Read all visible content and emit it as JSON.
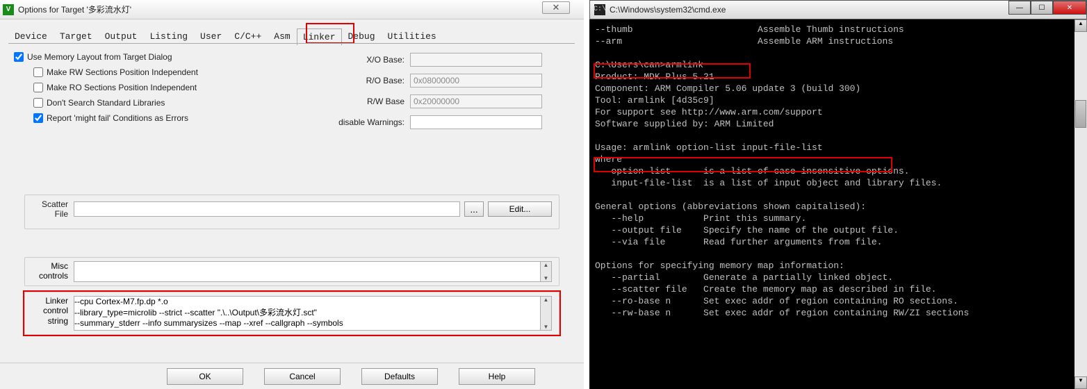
{
  "options": {
    "title": "Options for Target '多彩流水灯'",
    "close_label": "✕",
    "tabs": [
      "Device",
      "Target",
      "Output",
      "Listing",
      "User",
      "C/C++",
      "Asm",
      "Linker",
      "Debug",
      "Utilities"
    ],
    "active_tab_index": 7,
    "checks": {
      "use_memory_layout": {
        "label": "Use Memory Layout from Target Dialog",
        "checked": true
      },
      "make_rw": {
        "label": "Make RW Sections Position Independent",
        "checked": false
      },
      "make_ro": {
        "label": "Make RO Sections Position Independent",
        "checked": false
      },
      "dont_search": {
        "label": "Don't Search Standard Libraries",
        "checked": false
      },
      "report_might_fail": {
        "label": "Report 'might fail' Conditions as Errors",
        "checked": true
      }
    },
    "fields": {
      "xo_base": {
        "label": "X/O Base:",
        "value": ""
      },
      "ro_base": {
        "label": "R/O Base:",
        "value": "0x08000000"
      },
      "rw_base": {
        "label": "R/W Base",
        "value": "0x20000000"
      },
      "disable_warnings": {
        "label": "disable Warnings:",
        "value": ""
      }
    },
    "scatter": {
      "label": "Scatter\nFile",
      "value": "",
      "browse": "...",
      "edit": "Edit..."
    },
    "misc": {
      "label": "Misc\ncontrols",
      "value": ""
    },
    "linker_ctrl": {
      "label": "Linker\ncontrol\nstring",
      "value": "--cpu Cortex-M7.fp.dp *.o\n--library_type=microlib --strict --scatter \".\\..\\Output\\多彩流水灯.sct\"\n--summary_stderr --info summarysizes --map --xref --callgraph --symbols"
    },
    "buttons": {
      "ok": "OK",
      "cancel": "Cancel",
      "defaults": "Defaults",
      "help": "Help"
    }
  },
  "cmd": {
    "title": "C:\\Windows\\system32\\cmd.exe",
    "lines": [
      "--thumb                       Assemble Thumb instructions",
      "--arm                         Assemble ARM instructions",
      "",
      "C:\\Users\\can>armlink",
      "Product: MDK Plus 5.21",
      "Component: ARM Compiler 5.06 update 3 (build 300)",
      "Tool: armlink [4d35c9]",
      "For support see http://www.arm.com/support",
      "Software supplied by: ARM Limited",
      "",
      "Usage: armlink option-list input-file-list",
      "where",
      "   option-list      is a list of case-insensitive options.",
      "   input-file-list  is a list of input object and library files.",
      "",
      "General options (abbreviations shown capitalised):",
      "   --help           Print this summary.",
      "   --output file    Specify the name of the output file.",
      "   --via file       Read further arguments from file.",
      "",
      "Options for specifying memory map information:",
      "   --partial        Generate a partially linked object.",
      "   --scatter file   Create the memory map as described in file.",
      "   --ro-base n      Set exec addr of region containing RO sections.",
      "   --rw-base n      Set exec addr of region containing RW/ZI sections"
    ]
  }
}
